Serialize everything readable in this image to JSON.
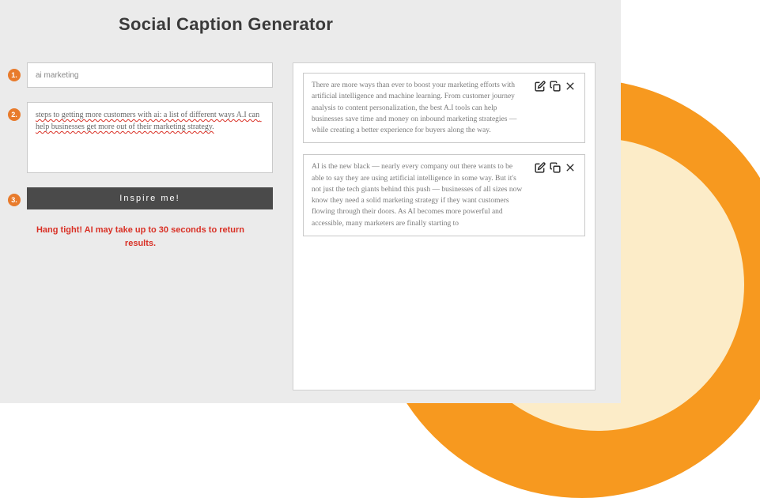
{
  "header": {
    "title": "Social Caption Generator"
  },
  "steps": {
    "step1_badge": "1.",
    "step2_badge": "2.",
    "step3_badge": "3."
  },
  "inputs": {
    "topic_value": "ai marketing",
    "details_value": "steps to getting more customers with ai: a list of different ways A.I can help businesses get more out of their marketing strategy."
  },
  "actions": {
    "inspire_label": "Inspire me!"
  },
  "status": {
    "wait_message": "Hang tight! AI may take up to 30 seconds to return results."
  },
  "results": [
    {
      "text": "There are more ways than ever to boost your marketing efforts with artificial intelligence and machine learning. From customer journey analysis to content personalization, the best A.I tools can help businesses save time and money on inbound marketing strategies — while creating a better experience for buyers along the way."
    },
    {
      "text": "AI is the new black — nearly every company out there wants to be able to say they are using artificial intelligence in some way. But it's not just the tech giants behind this push — businesses of all sizes now know they need a solid marketing strategy if they want customers flowing through their doors. As AI becomes more powerful and accessible, many marketers are finally starting to"
    }
  ]
}
